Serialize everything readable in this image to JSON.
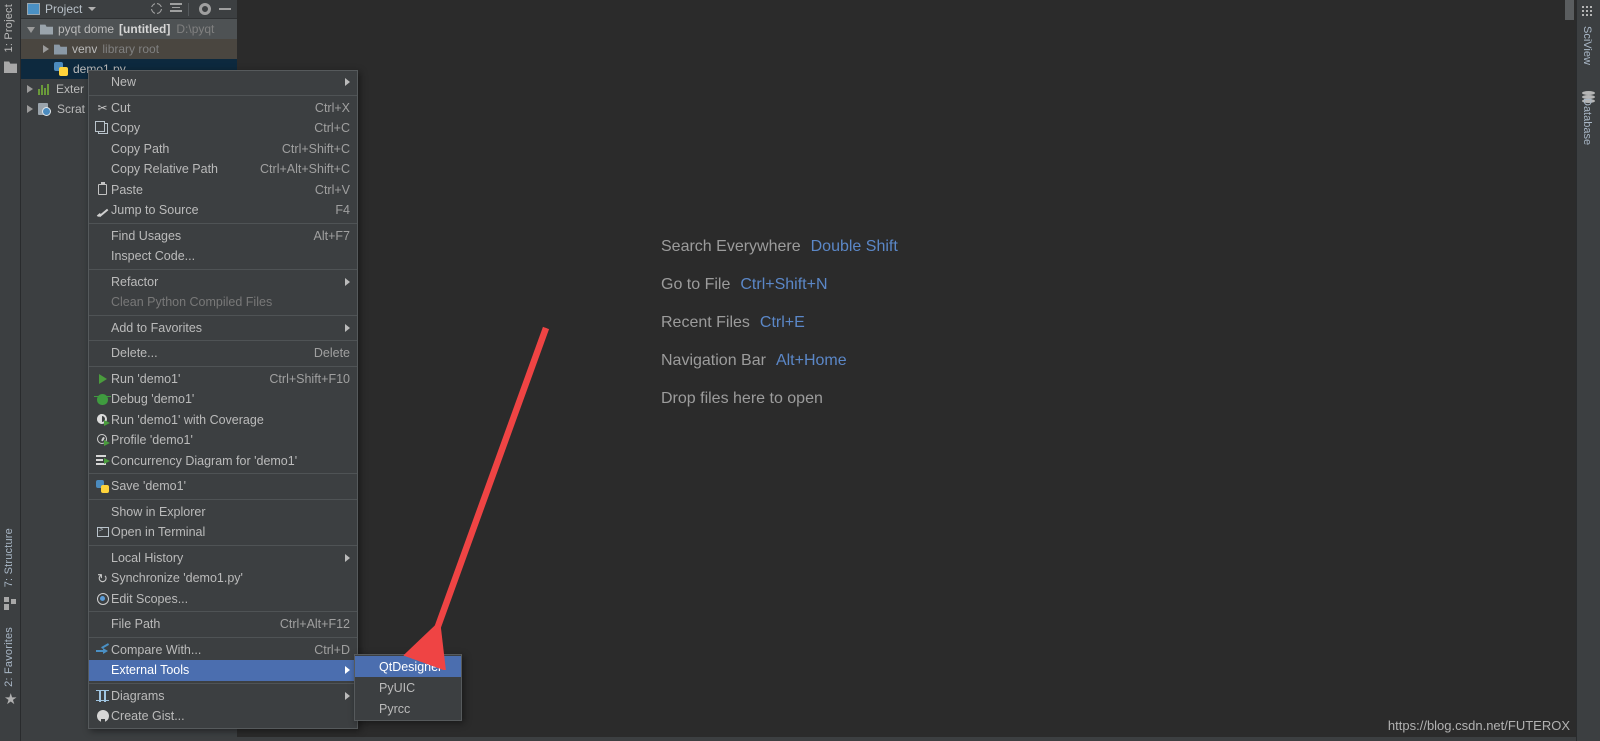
{
  "app": {
    "background_color": "#2b2b2b",
    "panel_color": "#3c3f41",
    "accent_blue": "#4b6eaf",
    "link_blue": "#5b87c7",
    "annotation_color": "#ef4444"
  },
  "left_strip": {
    "top_label": "1: Project",
    "bottom_labels": [
      "7: Structure",
      "2: Favorites"
    ],
    "icons": [
      "project-folder-icon",
      "structure-grid-icon",
      "favorites-star-icon"
    ]
  },
  "right_strip": {
    "labels": [
      "SciView",
      "Database"
    ],
    "icons": [
      "sciview-grid-icon",
      "database-cylinder-icon"
    ]
  },
  "project_panel": {
    "header": {
      "title": "Project",
      "caret": "▾",
      "buttons": [
        "target-icon",
        "collapse-all-icon",
        "gear-icon",
        "minimize-icon"
      ]
    },
    "tree": [
      {
        "label": "pyqt dome",
        "bold_suffix": "[untitled]",
        "path": "D:\\pyqt",
        "expanded": true,
        "icon": "folder-icon",
        "state": "root"
      },
      {
        "label": "venv",
        "suffix": "library root",
        "expanded": false,
        "icon": "folder-icon",
        "state": "venv"
      },
      {
        "label": "demo1.py",
        "icon": "python-file-icon",
        "state": "selected"
      },
      {
        "label": "Exter",
        "expanded": false,
        "icon": "external-libraries-icon",
        "state": "normal"
      },
      {
        "label": "Scrat",
        "expanded": false,
        "icon": "scratches-icon",
        "state": "normal"
      }
    ]
  },
  "editor_hints": [
    {
      "label": "Search Everywhere",
      "key": "Double Shift"
    },
    {
      "label": "Go to File",
      "key": "Ctrl+Shift+N"
    },
    {
      "label": "Recent Files",
      "key": "Ctrl+E"
    },
    {
      "label": "Navigation Bar",
      "key": "Alt+Home"
    },
    {
      "label": "Drop files here to open",
      "key": ""
    }
  ],
  "context_menu": {
    "items": [
      {
        "label": "New",
        "accel": "",
        "icon": "",
        "submenu": true,
        "type": "item"
      },
      {
        "type": "separator"
      },
      {
        "label": "Cut",
        "accel": "Ctrl+X",
        "icon": "scissors-icon",
        "type": "item"
      },
      {
        "label": "Copy",
        "accel": "Ctrl+C",
        "icon": "copy-icon",
        "type": "item"
      },
      {
        "label": "Copy Path",
        "accel": "Ctrl+Shift+C",
        "icon": "",
        "type": "item"
      },
      {
        "label": "Copy Relative Path",
        "accel": "Ctrl+Alt+Shift+C",
        "icon": "",
        "type": "item"
      },
      {
        "label": "Paste",
        "accel": "Ctrl+V",
        "icon": "paste-icon",
        "type": "item"
      },
      {
        "label": "Jump to Source",
        "accel": "F4",
        "icon": "pencil-icon",
        "type": "item"
      },
      {
        "type": "separator"
      },
      {
        "label": "Find Usages",
        "accel": "Alt+F7",
        "icon": "",
        "type": "item"
      },
      {
        "label": "Inspect Code...",
        "accel": "",
        "icon": "",
        "type": "item"
      },
      {
        "type": "separator"
      },
      {
        "label": "Refactor",
        "accel": "",
        "icon": "",
        "submenu": true,
        "type": "item"
      },
      {
        "label": "Clean Python Compiled Files",
        "accel": "",
        "icon": "",
        "disabled": true,
        "type": "item"
      },
      {
        "type": "separator"
      },
      {
        "label": "Add to Favorites",
        "accel": "",
        "icon": "",
        "submenu": true,
        "type": "item"
      },
      {
        "type": "separator"
      },
      {
        "label": "Delete...",
        "accel": "Delete",
        "icon": "",
        "type": "item"
      },
      {
        "type": "separator"
      },
      {
        "label": "Run 'demo1'",
        "accel": "Ctrl+Shift+F10",
        "icon": "run-play-icon",
        "type": "item"
      },
      {
        "label": "Debug 'demo1'",
        "accel": "",
        "icon": "debug-bug-icon",
        "type": "item"
      },
      {
        "label": "Run 'demo1' with Coverage",
        "accel": "",
        "icon": "coverage-icon",
        "type": "item"
      },
      {
        "label": "Profile 'demo1'",
        "accel": "",
        "icon": "profile-icon",
        "type": "item"
      },
      {
        "label": "Concurrency Diagram for 'demo1'",
        "accel": "",
        "icon": "concurrency-icon",
        "type": "item"
      },
      {
        "type": "separator"
      },
      {
        "label": "Save 'demo1'",
        "accel": "",
        "icon": "python-save-icon",
        "type": "item"
      },
      {
        "type": "separator"
      },
      {
        "label": "Show in Explorer",
        "accel": "",
        "icon": "",
        "type": "item"
      },
      {
        "label": "Open in Terminal",
        "accel": "",
        "icon": "terminal-icon",
        "type": "item"
      },
      {
        "type": "separator"
      },
      {
        "label": "Local History",
        "accel": "",
        "icon": "",
        "submenu": true,
        "type": "item"
      },
      {
        "label": "Synchronize 'demo1.py'",
        "accel": "",
        "icon": "sync-icon",
        "type": "item"
      },
      {
        "label": "Edit Scopes...",
        "accel": "",
        "icon": "scope-icon",
        "type": "item"
      },
      {
        "type": "separator"
      },
      {
        "label": "File Path",
        "accel": "Ctrl+Alt+F12",
        "icon": "",
        "type": "item"
      },
      {
        "type": "separator"
      },
      {
        "label": "Compare With...",
        "accel": "Ctrl+D",
        "icon": "compare-icon",
        "type": "item"
      },
      {
        "label": "External Tools",
        "accel": "",
        "icon": "",
        "submenu": true,
        "highlighted": true,
        "type": "item"
      },
      {
        "type": "separator"
      },
      {
        "label": "Diagrams",
        "accel": "",
        "icon": "diagram-icon",
        "submenu": true,
        "type": "item"
      },
      {
        "label": "Create Gist...",
        "accel": "",
        "icon": "github-icon",
        "type": "item"
      }
    ]
  },
  "external_tools_submenu": {
    "items": [
      {
        "label": "QtDesigner",
        "highlighted": true
      },
      {
        "label": "PyUIC",
        "highlighted": false
      },
      {
        "label": "Pyrcc",
        "highlighted": false
      }
    ]
  },
  "watermark": {
    "text": "https://blog.csdn.net/FUTEROX"
  }
}
